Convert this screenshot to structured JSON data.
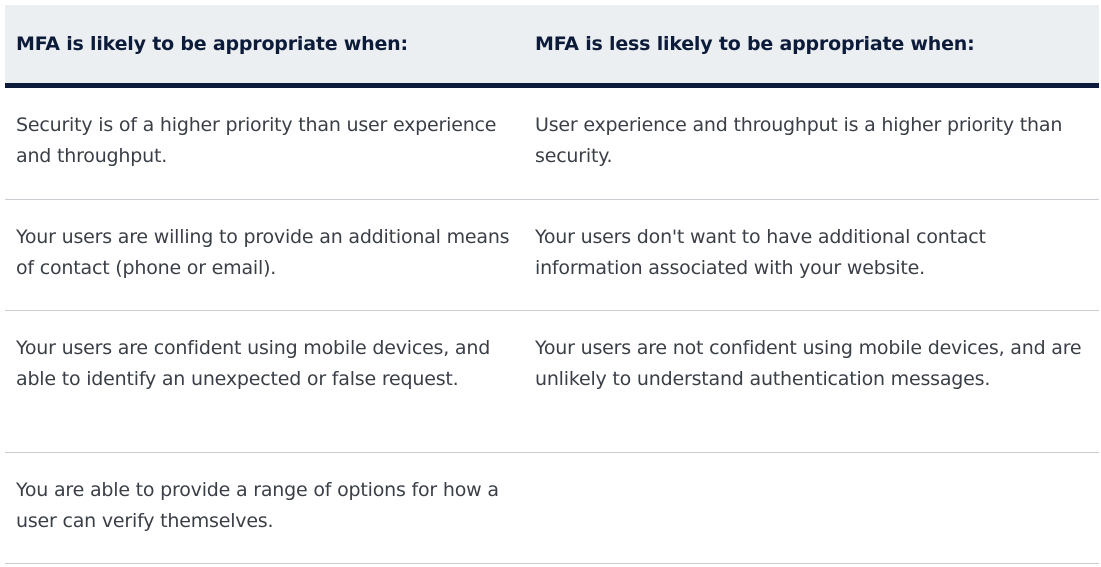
{
  "table": {
    "headers": [
      "MFA is likely to be appropriate when:",
      "MFA is less likely to be appropriate when:"
    ],
    "rows": [
      [
        "Security is of a higher priority than user experience and throughput.",
        "User experience and throughput is a higher priority than security."
      ],
      [
        "Your users are willing to provide an additional means of contact (phone or email).",
        "Your users don't want to have additional contact information associated with your website."
      ],
      [
        "Your users are confident using mobile devices, and able to identify an unexpected or false request.",
        "Your users are not confident using mobile devices, and are unlikely to understand authentication messages."
      ],
      [
        "You are able to provide a range of options for how a user can verify themselves.",
        ""
      ]
    ]
  },
  "colors": {
    "header_background": "#eceff1",
    "header_text": "#0c1b3a",
    "header_rule": "#0c1b3a",
    "body_text": "#3a3f47",
    "row_divider": "#c9ccd0"
  }
}
